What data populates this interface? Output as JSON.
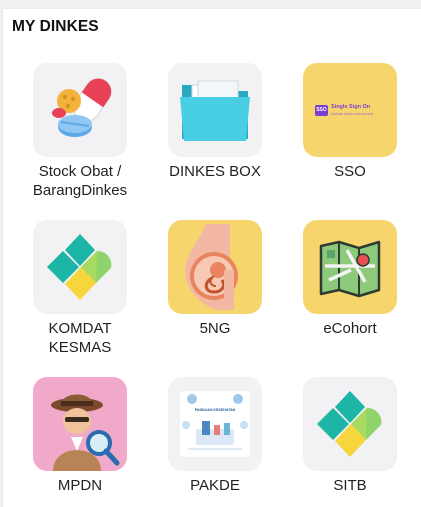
{
  "section": {
    "title": "MY DINKES"
  },
  "apps": [
    {
      "label": "Stock Obat / BarangDinkes",
      "icon": "pills-icon"
    },
    {
      "label": "DINKES BOX",
      "icon": "folder-icon"
    },
    {
      "label": "SSO",
      "icon": "sso-icon",
      "badge": "SSO",
      "heading": "Single Sign On",
      "subtext": "Aplikasi dalam satu tempat"
    },
    {
      "label": "KOMDAT KESMAS",
      "icon": "kemenkes-logo-icon"
    },
    {
      "label": "5NG",
      "icon": "pregnancy-icon"
    },
    {
      "label": "eCohort",
      "icon": "map-icon"
    },
    {
      "label": "MPDN",
      "icon": "detective-icon"
    },
    {
      "label": "PAKDE",
      "icon": "infographic-icon",
      "heading": "PANDUAN KESEHATAN"
    },
    {
      "label": "SITB",
      "icon": "kemenkes-logo-icon"
    }
  ],
  "colors": {
    "tile_gray": "#f2f2f4",
    "tile_yellow": "#f6d66c",
    "tile_pink": "#f0a9c9",
    "folder_cyan": "#3cc5dc",
    "sso_purple": "#7b3fd0"
  }
}
